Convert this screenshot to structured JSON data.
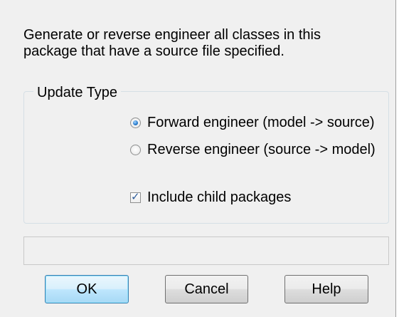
{
  "description": "Generate or reverse engineer all classes in this\npackage that have a source file specified.",
  "update_type": {
    "legend": "Update Type",
    "options": [
      {
        "label": "Forward engineer (model -> source)",
        "checked": true
      },
      {
        "label": "Reverse engineer (source -> model)",
        "checked": false
      }
    ]
  },
  "include_child": {
    "label": "Include child packages",
    "checked": true,
    "mark": "✓"
  },
  "status_text": "",
  "buttons": {
    "ok": "OK",
    "cancel": "Cancel",
    "help": "Help"
  },
  "colors": {
    "background": "#f0f0f0",
    "default_button_border": "#3c7fb1",
    "radio_dot": "#2d7fd0"
  }
}
